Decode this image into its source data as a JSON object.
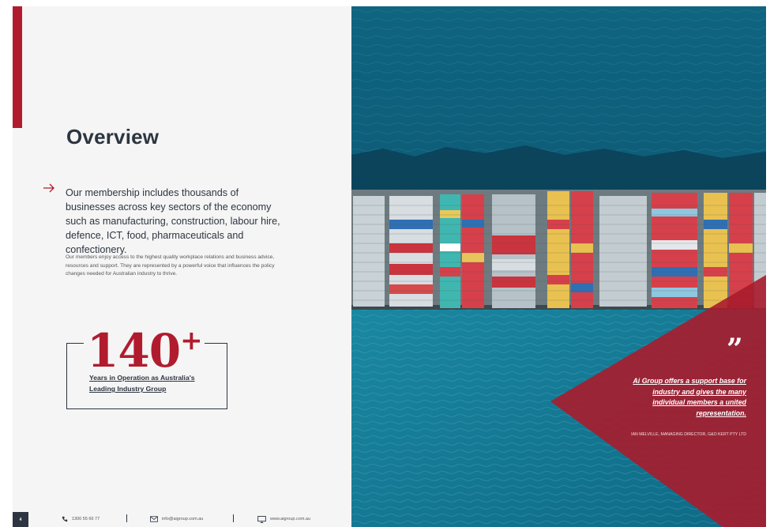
{
  "colors": {
    "accent": "#b01c2e",
    "dark": "#2d3540",
    "sea": "#0f6c86"
  },
  "overview": {
    "title": "Overview",
    "arrow_icon": "arrow-right-icon",
    "lead": "Our membership includes thousands of businesses across key sectors of the economy such as manufacturing, construction, labour hire, defence, ICT, food, pharmaceuticals and confectionery.",
    "body": "Our members enjoy access to the highest quality workplace relations and business advice, resources and support. They are represented by a powerful voice that influences the policy changes needed for Australian industry to thrive."
  },
  "stat": {
    "number": "140",
    "suffix": "+",
    "label": "Years in Operation as Australia's Leading Industry Group"
  },
  "footer": {
    "page_number": "4",
    "phone": "1300 55 66 77",
    "email": "info@aigroup.com.au",
    "website": "www.aigroup.com.au"
  },
  "quote": {
    "mark": "”",
    "text": "Ai Group offers a support base for industry and gives the many individual members a united representation.",
    "attribution": "IAN MELVILLE, MANAGING DIRECTOR, G&O KERT PTY LTD"
  }
}
